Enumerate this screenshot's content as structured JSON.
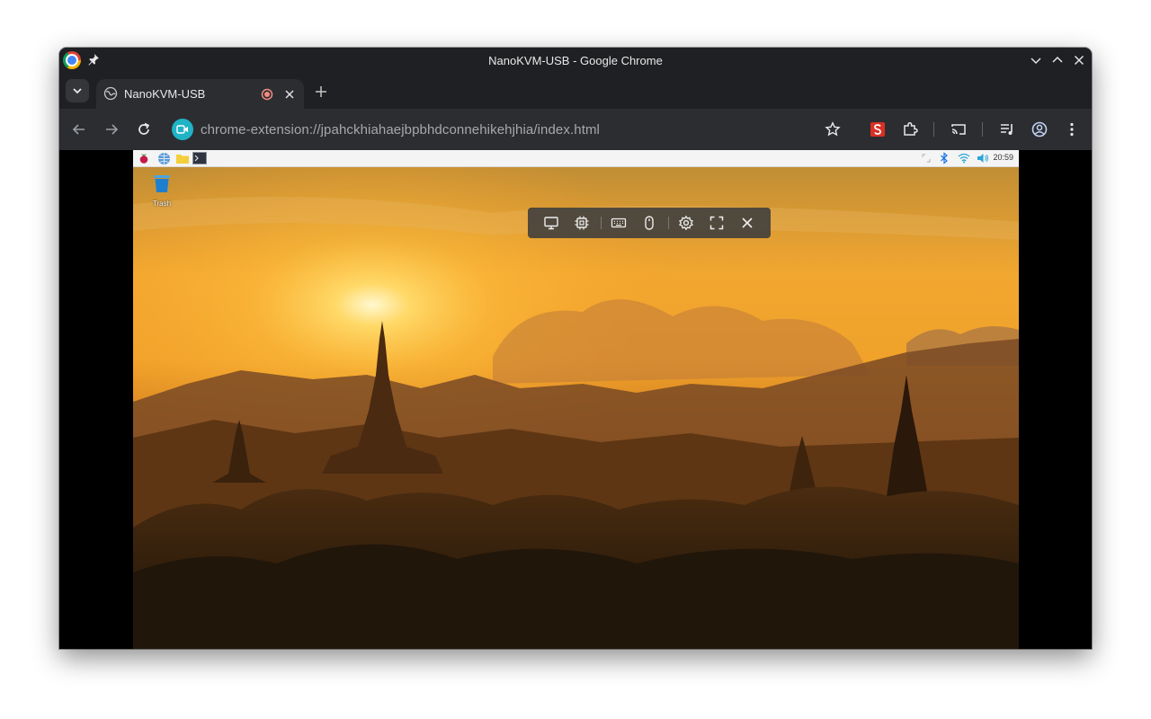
{
  "window": {
    "title": "NanoKVM-USB - Google Chrome"
  },
  "tab": {
    "title": "NanoKVM-USB",
    "favicon": "globe-icon"
  },
  "toolbar": {
    "url": "chrome-extension://jpahckhiahaejbpbhdconnehikehjhia/index.html"
  },
  "remote_desktop": {
    "trash_label": "Trash",
    "clock": "20:59",
    "kvm_toolbar": [
      "monitor-icon",
      "chip-icon",
      "keyboard-icon",
      "mouse-icon",
      "gear-icon",
      "fullscreen-icon",
      "close-icon"
    ]
  },
  "colors": {
    "chrome_dark": "#1f2023",
    "toolbar_bg": "#2c2d31",
    "accent_teal": "#1fb3c5",
    "record_red": "#f28b82"
  }
}
